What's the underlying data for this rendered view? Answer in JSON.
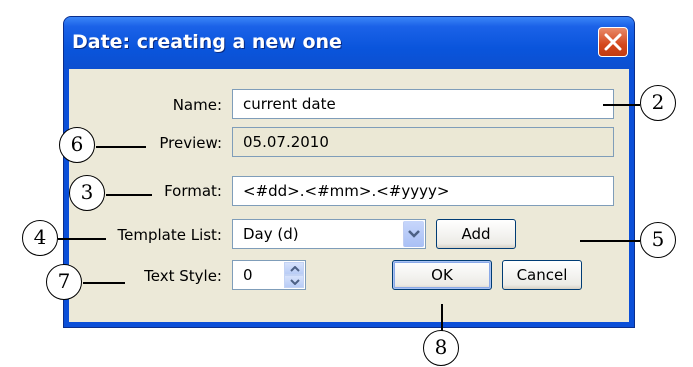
{
  "dialog": {
    "title": "Date: creating a new one",
    "close_icon": "close-icon"
  },
  "form": {
    "name_label": "Name:",
    "name_value": "current date",
    "preview_label": "Preview:",
    "preview_value": "05.07.2010",
    "format_label": "Format:",
    "format_value": "<#dd>.<#mm>.<#yyyy>",
    "template_label": "Template List:",
    "template_value": "Day (d)",
    "template_dropdown_icon": "chevron-down-icon",
    "add_label": "Add",
    "textstyle_label": "Text Style:",
    "textstyle_value": "0",
    "spinner_icon": "spinner-arrows-icon",
    "ok_label": "OK",
    "cancel_label": "Cancel"
  },
  "callouts": {
    "c2": "2",
    "c3": "3",
    "c4": "4",
    "c5": "5",
    "c6": "6",
    "c7": "7",
    "c8": "8"
  },
  "colors": {
    "titlebar": "#0a55dc",
    "client": "#ece9d8",
    "close_button": "#d4471c"
  }
}
